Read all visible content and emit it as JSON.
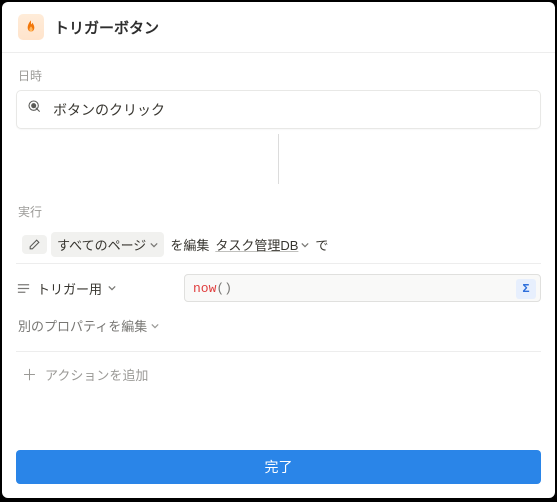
{
  "header": {
    "title": "トリガーボタン"
  },
  "triggerSection": {
    "label": "日時",
    "event": "ボタンのクリック"
  },
  "execSection": {
    "label": "実行",
    "pagesChip": "すべてのページ",
    "editWord": "を編集",
    "dbName": "タスク管理DB",
    "deWord": "で"
  },
  "property": {
    "name": "トリガー用",
    "formulaNow": "now",
    "formulaParen": "()"
  },
  "editAnother": "別のプロパティを編集",
  "addAction": "アクションを追加",
  "doneLabel": "完了"
}
